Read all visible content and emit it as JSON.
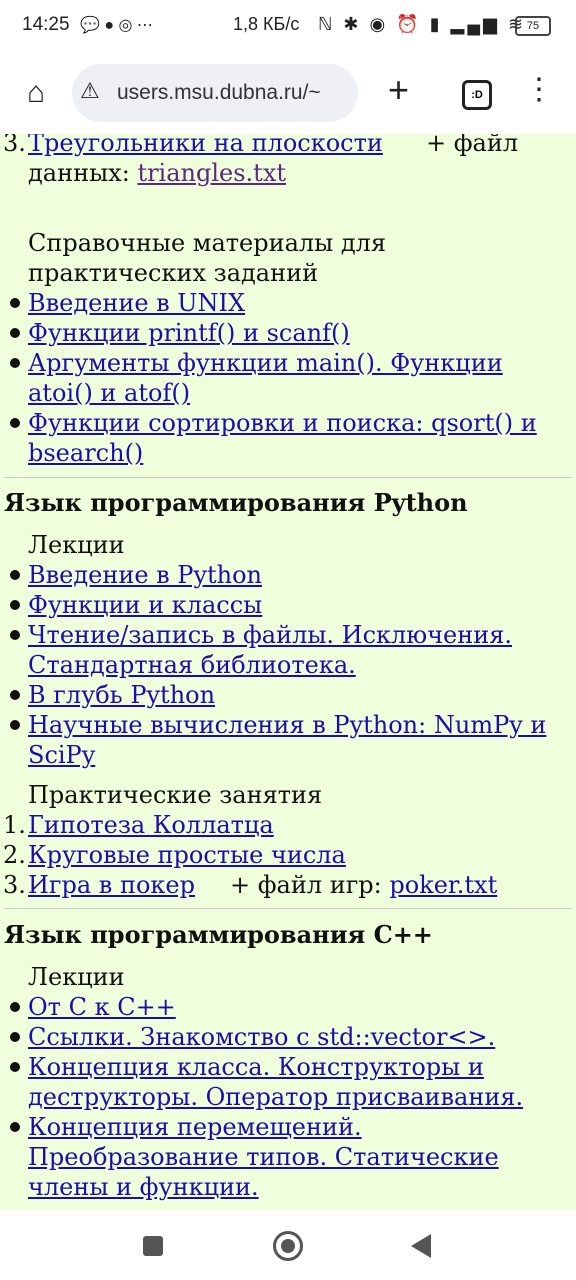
{
  "status_bar": {
    "time": "14:25",
    "net_speed": "1,8 КБ/с",
    "battery": "75",
    "left_icons": "💬 ● ◎ ⋯",
    "right_icons": "ℕ ✱ ◉ ⏰ ▮ ▂▄▆ ≋"
  },
  "browser": {
    "url": "users.msu.dubna.ru/~",
    "tab_count_label": ":D"
  },
  "page": {
    "top_item_num": "3.",
    "top_item_link": "Треугольники на плоскости",
    "top_item_extra": "+ файл",
    "top_item_data_label": "данных: ",
    "top_item_data_link": "triangles.txt",
    "ref_heading_1": "Справочные материалы для",
    "ref_heading_2": "практических заданий",
    "ref_items": [
      [
        "Введение в UNIX"
      ],
      [
        "Функции printf() и scanf()"
      ],
      [
        "Аргументы функции main(). Функции",
        "atoi() и atof()"
      ],
      [
        "Функции сортировки и поиска: qsort() и",
        "bsearch()"
      ]
    ],
    "python_heading": "Язык программирования Python",
    "python_lectures_label": "Лекции",
    "python_lectures": [
      [
        "Введение в Python"
      ],
      [
        "Функции и классы"
      ],
      [
        "Чтение/запись в файлы. Исключения.",
        "Стандартная библиотека."
      ],
      [
        "В глубь Python"
      ],
      [
        "Научные вычисления в Python: NumPy и",
        "SciPy"
      ]
    ],
    "python_practice_label": "Практические занятия",
    "python_practice": [
      {
        "num": "1.",
        "text": "Гипотеза Коллатца"
      },
      {
        "num": "2.",
        "text": "Круговые простые числа"
      },
      {
        "num": "3.",
        "text": "Игра в покер",
        "extra": "+ файл игр: ",
        "extra_link": "poker.txt"
      }
    ],
    "cpp_heading": "Язык программирования C++",
    "cpp_lectures_label": "Лекции",
    "cpp_lectures": [
      [
        "От С к C++"
      ],
      [
        "Ссылки. Знакомство с std::vector<>."
      ],
      [
        "Концепция класса. Конструкторы и",
        "деструкторы. Оператор присваивания."
      ],
      [
        "Концепция перемещений.",
        "Преобразование типов. Статические",
        "члены и функции."
      ]
    ]
  }
}
